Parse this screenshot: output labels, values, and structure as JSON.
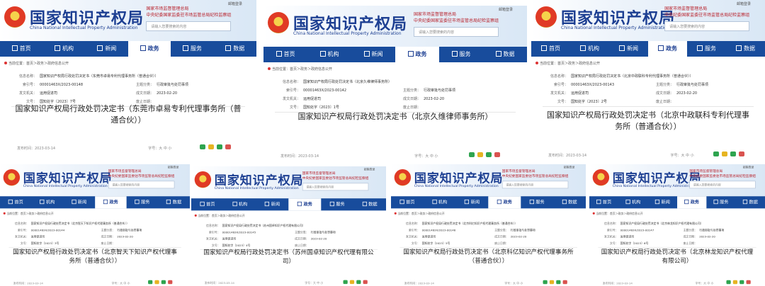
{
  "common": {
    "brand": "国家知识产权局",
    "brand_en": "China National Intellectual Property Administration",
    "top_link_1": "国家市场监督管理总局",
    "top_link_2": "中央纪委国家监委驻市场监管总局纪检监察组",
    "login": "邮箱登录",
    "search_placeholder": "请输入您要搜索的内容",
    "nav": [
      "首页",
      "机构",
      "新闻",
      "政务",
      "服务",
      "数据"
    ],
    "crumb": "当前位置：首页＞政务＞政府信息公开",
    "labels": {
      "index": "索引号：",
      "subject": "主题分类：",
      "issuer": "发文机关：",
      "date": "成文日期：",
      "docno": "文号：",
      "abolish": "废止日期：",
      "info_name": "信息名称："
    },
    "subject": "行政审批与处罚事项",
    "issuer": "运用促进司",
    "date": "2023-02-20",
    "pub": "发布时间：2023-03-14",
    "font_size": "字号：大 中 小"
  },
  "shots": [
    {
      "name": "国家知识产权局行政处罚决定书（东莞市卓易专利代理事务所（普通合伙））",
      "index": "00001463X/2023-00148",
      "docno": "国知处字〔2023〕7号",
      "title": "国家知识产权局行政处罚决定书（东莞市卓易专利代理事务所（普通合伙））"
    },
    {
      "name": "国家知识产权局行政处罚决定书（北京久维律师事务所）",
      "index": "00001463X/2023-00142",
      "docno": "国知处字〔2023〕1号",
      "title": "国家知识产权局行政处罚决定书（北京久维律师事务所）"
    },
    {
      "name": "国家知识产权局行政处罚决定书（北京中政联科专利代理事务所（普通合伙））",
      "index": "00001463X/2023-00143",
      "docno": "国知处字〔2023〕2号",
      "title": "国家知识产权局行政处罚决定书（北京中政联科专利代理事务所（普通合伙））"
    },
    {
      "name": "国家知识产权局行政处罚决定书（北京智天下知识产权代理事务所（普通合伙））",
      "index": "00001463X/2023-00144",
      "docno": "国知处字〔2023〕3号",
      "title": "国家知识产权局行政处罚决定书（北京智天下知识产权代理事务所（普通合伙））"
    },
    {
      "name": "国家知识产权局行政处罚决定书（苏州国卓知识产权代理有限公司）",
      "index": "00001463X/2023-00145",
      "docno": "国知处字〔2023〕4号",
      "title": "国家知识产权局行政处罚决定书（苏州国卓知识产权代理有限公司）"
    },
    {
      "name": "国家知识产权局行政处罚决定书（北京科亿知识产权代理事务所（普通合伙））",
      "index": "00001463X/2023-00146",
      "docno": "国知处字〔2023〕5号",
      "title": "国家知识产权局行政处罚决定书（北京科亿知识产权代理事务所（普通合伙））"
    },
    {
      "name": "国家知识产权局行政处罚决定书（北京林龙知识产权代理有限公司）",
      "index": "00001463X/2023-00147",
      "docno": "国知处字〔2023〕6号",
      "title": "国家知识产权局行政处罚决定书（北京林龙知识产权代理有限公司）"
    }
  ]
}
